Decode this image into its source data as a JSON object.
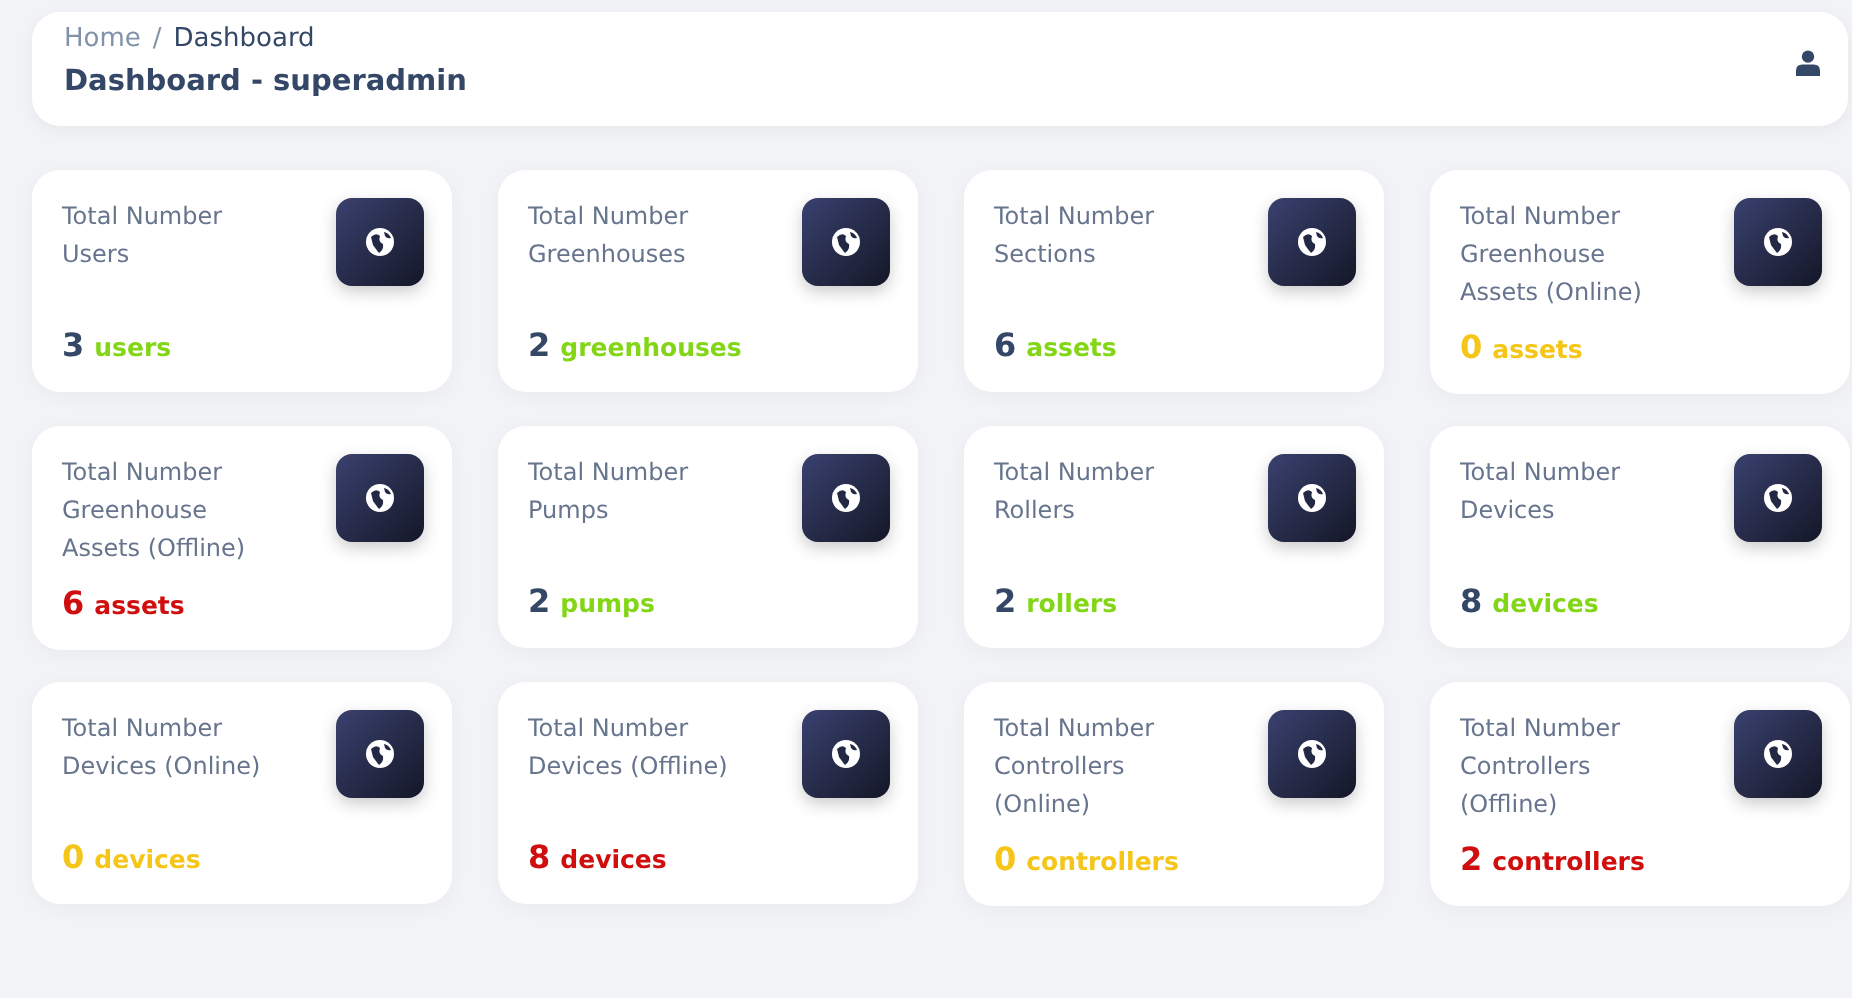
{
  "header": {
    "breadcrumb": [
      {
        "label": "Home",
        "current": false
      },
      {
        "label": "Dashboard",
        "current": true
      }
    ],
    "separator": "/",
    "title": "Dashboard - superadmin"
  },
  "cards": [
    {
      "title": [
        "Total Number",
        "Users"
      ],
      "count": "3",
      "unit": "users",
      "kind": "success"
    },
    {
      "title": [
        "Total Number",
        "Greenhouses"
      ],
      "count": "2",
      "unit": "greenhouses",
      "kind": "success"
    },
    {
      "title": [
        "Total Number",
        "Sections"
      ],
      "count": "6",
      "unit": "assets",
      "kind": "success"
    },
    {
      "title": [
        "Total Number",
        "Greenhouse",
        "Assets (Online)"
      ],
      "count": "0",
      "unit": "assets",
      "kind": "warning"
    },
    {
      "title": [
        "Total Number",
        "Greenhouse",
        "Assets (Offline)"
      ],
      "count": "6",
      "unit": "assets",
      "kind": "danger"
    },
    {
      "title": [
        "Total Number",
        "Pumps"
      ],
      "count": "2",
      "unit": "pumps",
      "kind": "success"
    },
    {
      "title": [
        "Total Number",
        "Rollers"
      ],
      "count": "2",
      "unit": "rollers",
      "kind": "success"
    },
    {
      "title": [
        "Total Number",
        "Devices"
      ],
      "count": "8",
      "unit": "devices",
      "kind": "success"
    },
    {
      "title": [
        "Total Number",
        "Devices (Online)"
      ],
      "count": "0",
      "unit": "devices",
      "kind": "warning"
    },
    {
      "title": [
        "Total Number",
        "Devices (Offline)"
      ],
      "count": "8",
      "unit": "devices",
      "kind": "danger"
    },
    {
      "title": [
        "Total Number",
        "Controllers",
        "(Online)"
      ],
      "count": "0",
      "unit": "controllers",
      "kind": "warning"
    },
    {
      "title": [
        "Total Number",
        "Controllers",
        "(Offline)"
      ],
      "count": "2",
      "unit": "controllers",
      "kind": "danger"
    }
  ]
}
